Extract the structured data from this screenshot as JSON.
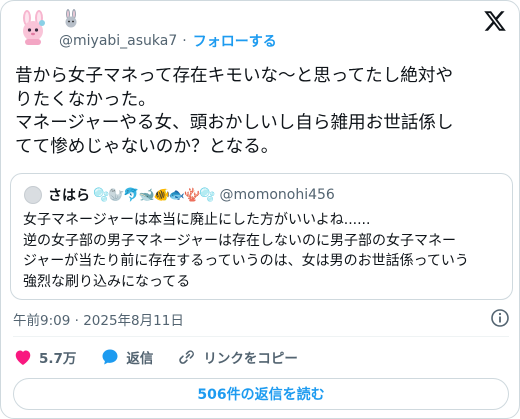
{
  "author": {
    "handle": "@miyabi_asuka7",
    "separator": "·",
    "follow_label": "フォローする"
  },
  "tweet": {
    "lines": [
      "昔から女子マネって存在キモいな〜と思ってたし絶対や",
      "りたくなかった。",
      "マネージャーやる女、頭おかしいし自ら雑用お世話係し",
      "てて惨めじゃないのか？となる。"
    ]
  },
  "quote": {
    "name": "さはら",
    "name_emoji": "🫧🦭🐬🐋🐠🐟🪸🫧",
    "handle": "@momonohi456",
    "lines": [
      "女子マネージャーは本当に廃止にした方がいいよね......",
      "逆の女子部の男子マネージャーは存在しないのに男子部の女子マネー",
      "ジャーが当たり前に存在するっていうのは、女は男のお世話係っていう",
      "強烈な刷り込みになってる"
    ]
  },
  "timestamp": "午前9:09 · 2025年8月11日",
  "actions": {
    "like_count": "5.7万",
    "reply_label": "返信",
    "copy_link_label": "リンクをコピー"
  },
  "read_replies_label": "506件の返信を読む",
  "colors": {
    "accent": "#1d9bf0",
    "like": "#f91880",
    "secondary_text": "#536471",
    "border": "#cfd9de"
  }
}
